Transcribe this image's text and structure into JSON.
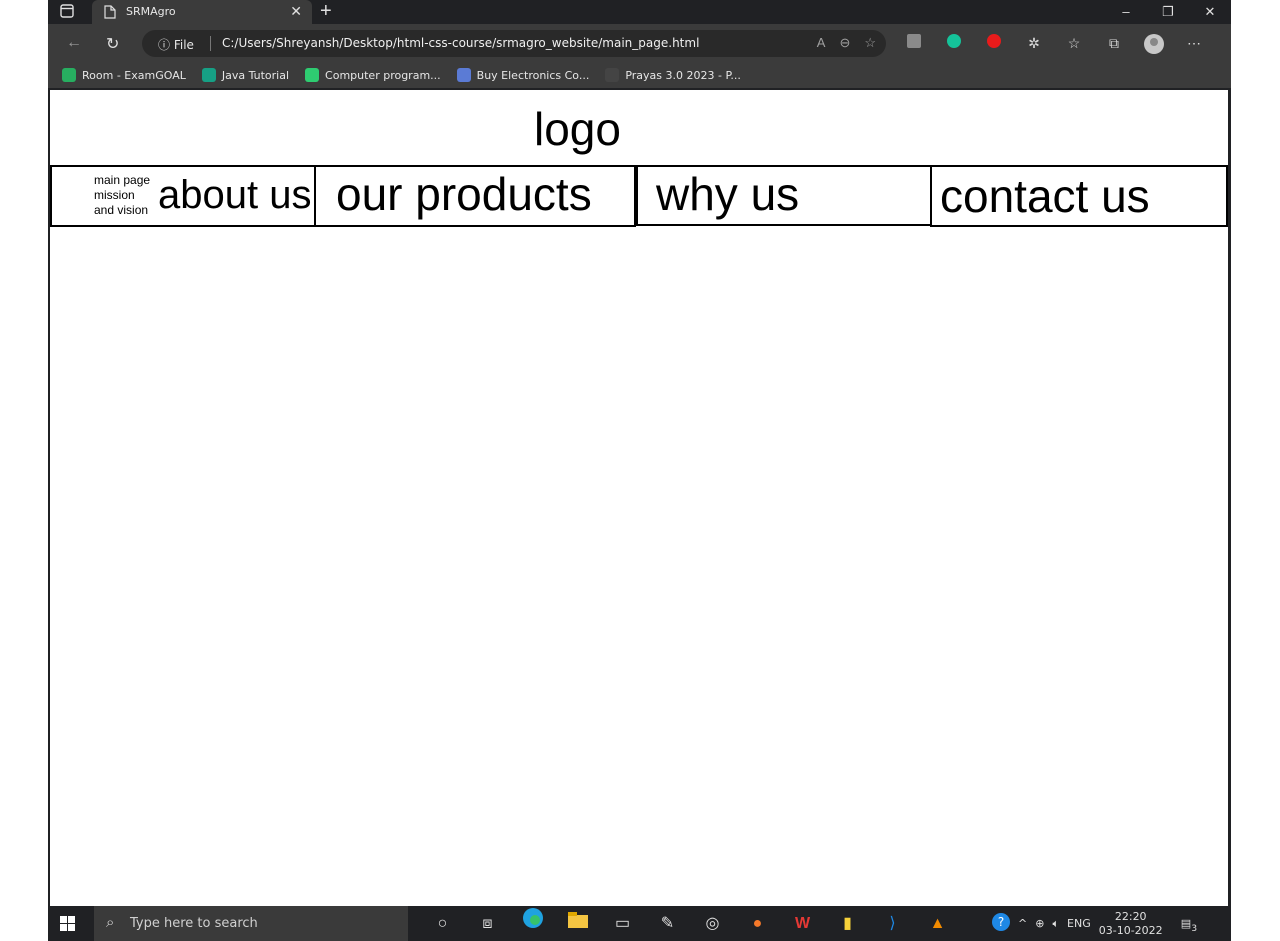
{
  "browser": {
    "tab_title": "SRMAgro",
    "new_tab": "+",
    "address": {
      "scheme_label": "File",
      "url": "C:/Users/Shreyansh/Desktop/html-css-course/srmagro_website/main_page.html"
    },
    "bookmarks": [
      {
        "label": "Room - ExamGOAL",
        "color": "#27ae60"
      },
      {
        "label": "Java Tutorial",
        "color": "#16a085"
      },
      {
        "label": "Computer program...",
        "color": "#2ecc71"
      },
      {
        "label": "Buy Electronics Co...",
        "color": "#5b7bd5"
      },
      {
        "label": "Prayas 3.0 2023 - P...",
        "color": "#444444"
      }
    ]
  },
  "page": {
    "logo": "logo",
    "nav": {
      "about_sub": [
        "main page",
        "mission",
        "and vision"
      ],
      "about": "about us",
      "products": "our products",
      "why": "why us",
      "contact": "contact us"
    }
  },
  "taskbar": {
    "search_placeholder": "Type here to search",
    "language": "ENG",
    "time": "22:20",
    "date": "03-10-2022",
    "notifications": "3"
  }
}
